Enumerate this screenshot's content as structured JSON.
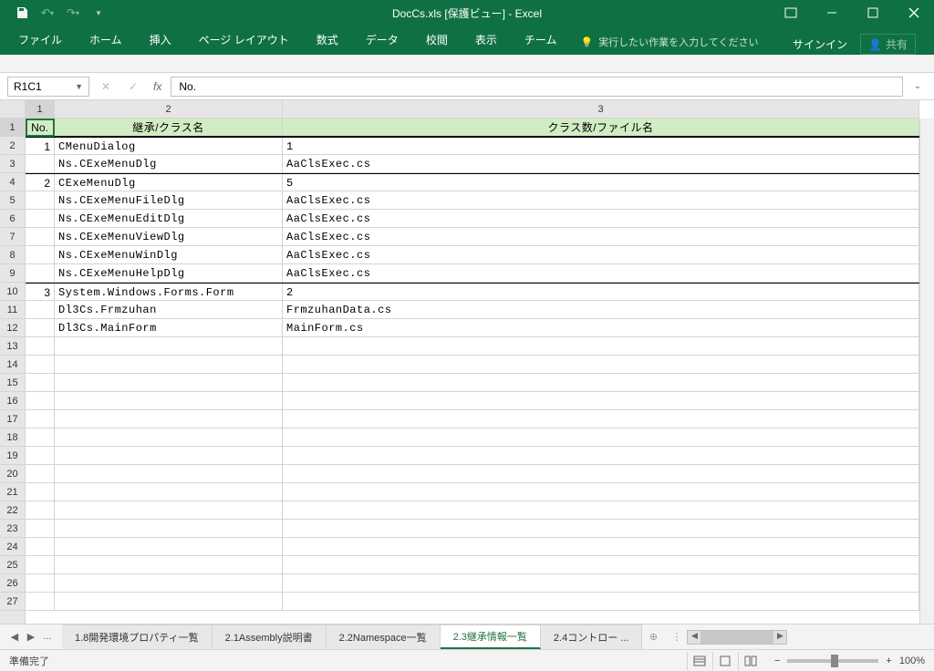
{
  "title": "DocCs.xls [保護ビュー] - Excel",
  "qat": {
    "undo": "↶",
    "redo": "↷"
  },
  "win": {
    "min": "—",
    "max": "☐",
    "close": "✕",
    "ribbon_opts": "⬚"
  },
  "ribbon": {
    "tabs": [
      "ファイル",
      "ホーム",
      "挿入",
      "ページ レイアウト",
      "数式",
      "データ",
      "校閲",
      "表示",
      "チーム"
    ],
    "tell_me": "実行したい作業を入力してください",
    "signin": "サインイン",
    "share": "共有"
  },
  "name_box": "R1C1",
  "formula": "No.",
  "col_h": [
    "1",
    "2",
    "3"
  ],
  "row_h": [
    "1",
    "2",
    "3",
    "4",
    "5",
    "6",
    "7",
    "8",
    "9",
    "10",
    "11",
    "12",
    "13",
    "14",
    "15",
    "16",
    "17",
    "18",
    "19",
    "20",
    "21",
    "22",
    "23",
    "24",
    "25",
    "26",
    "27"
  ],
  "header_row": {
    "c1": "No.",
    "c2": "継承/クラス名",
    "c3": "クラス数/ファイル名"
  },
  "rows": [
    {
      "no": "1",
      "c2": "CMenuDialog",
      "c3": "1",
      "grp": true
    },
    {
      "no": "",
      "c2": "Ns.CExeMenuDlg",
      "c3": "AaClsExec.cs"
    },
    {
      "no": "2",
      "c2": "CExeMenuDlg",
      "c3": "5",
      "grp": true
    },
    {
      "no": "",
      "c2": "Ns.CExeMenuFileDlg",
      "c3": "AaClsExec.cs"
    },
    {
      "no": "",
      "c2": "Ns.CExeMenuEditDlg",
      "c3": "AaClsExec.cs"
    },
    {
      "no": "",
      "c2": "Ns.CExeMenuViewDlg",
      "c3": "AaClsExec.cs"
    },
    {
      "no": "",
      "c2": "Ns.CExeMenuWinDlg",
      "c3": "AaClsExec.cs"
    },
    {
      "no": "",
      "c2": "Ns.CExeMenuHelpDlg",
      "c3": "AaClsExec.cs"
    },
    {
      "no": "3",
      "c2": "System.Windows.Forms.Form",
      "c3": "2",
      "grp": true
    },
    {
      "no": "",
      "c2": "Dl3Cs.Frmzuhan",
      "c3": "FrmzuhanData.cs"
    },
    {
      "no": "",
      "c2": "Dl3Cs.MainForm",
      "c3": "MainForm.cs"
    }
  ],
  "tabs": {
    "nav_ellipsis": "...",
    "list": [
      "1.8開発環境プロパティ一覧",
      "2.1Assembly説明書",
      "2.2Namespace一覧",
      "2.3継承情報一覧",
      "2.4コントロー ..."
    ],
    "active": 3
  },
  "status": "準備完了",
  "zoom": "100%"
}
